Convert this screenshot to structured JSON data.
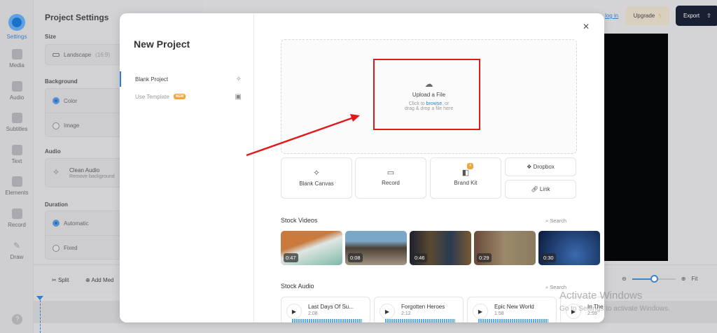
{
  "rail": [
    {
      "label": "Settings",
      "active": true
    },
    {
      "label": "Media"
    },
    {
      "label": "Audio"
    },
    {
      "label": "Subtitles"
    },
    {
      "label": "Text"
    },
    {
      "label": "Elements"
    },
    {
      "label": "Record"
    },
    {
      "label": "Draw"
    }
  ],
  "settings": {
    "title": "Project Settings",
    "size_label": "Size",
    "size_value": "Landscape",
    "size_ratio": "(16:9)",
    "background_label": "Background",
    "bg_color": "Color",
    "bg_image": "Image",
    "audio_label": "Audio",
    "clean_audio": "Clean Audio",
    "clean_audio_sub": "Remove background",
    "duration_label": "Duration",
    "dur_auto": "Automatic",
    "dur_fixed": "Fixed"
  },
  "timeline": {
    "split": "Split",
    "add_media": "Add Med",
    "zoom_fit": "Fit",
    "zoom_level": 0.5
  },
  "header": {
    "login": "log in",
    "upgrade": "Upgrade",
    "export": "Export"
  },
  "modal": {
    "title": "New Project",
    "nav": [
      {
        "label": "Blank Project",
        "active": true
      },
      {
        "label": "Use Template",
        "badge": "NEW"
      }
    ],
    "upload": {
      "title": "Upload a File",
      "line1_pre": "Click to ",
      "browse": "browse",
      ",": "",
      "line1_post": ", or",
      "line2": "drag & drop a file here"
    },
    "cards": {
      "blank_canvas": "Blank Canvas",
      "record": "Record",
      "brand_kit": "Brand Kit",
      "brand_badge": "4",
      "dropbox": "Dropbox",
      "link": "Link"
    },
    "stock_videos": {
      "title": "Stock Videos",
      "search": "Search",
      "items": [
        {
          "duration": "0:47"
        },
        {
          "duration": "0:08"
        },
        {
          "duration": "0:46"
        },
        {
          "duration": "0:29"
        },
        {
          "duration": "0:30"
        }
      ]
    },
    "stock_audio": {
      "title": "Stock Audio",
      "search": "Search",
      "items": [
        {
          "title": "Last Days Of Su...",
          "time": "2:08"
        },
        {
          "title": "Forgotten Heroes",
          "time": "2:12"
        },
        {
          "title": "Epic New World",
          "time": "1:58"
        },
        {
          "title": "In The",
          "time": "2:59"
        }
      ]
    }
  },
  "watermark": {
    "line1": "Activate Windows",
    "line2": "Go to Settings to activate Windows."
  },
  "colors": {
    "accent": "#2a7fd4",
    "annotation": "#e01a1a",
    "export_bg": "#1a2033"
  }
}
